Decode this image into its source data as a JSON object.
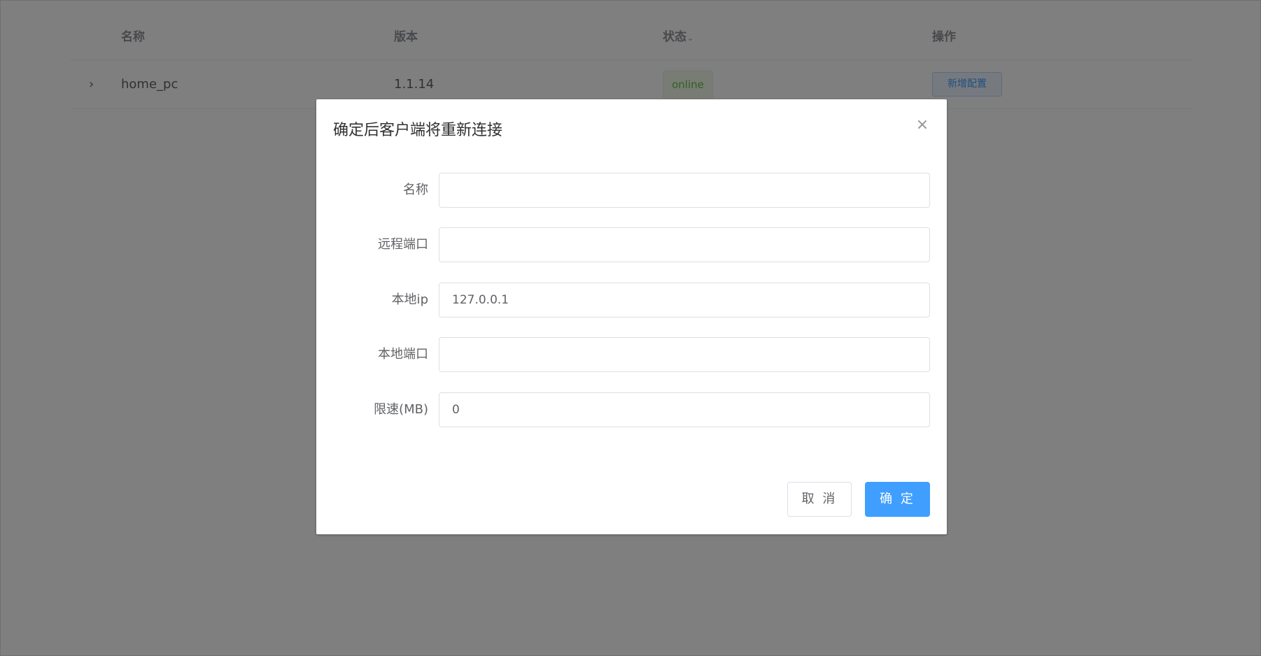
{
  "table": {
    "columns": [
      {
        "label": "名称"
      },
      {
        "label": "版本"
      },
      {
        "label": "状态",
        "sortable": true
      },
      {
        "label": "操作"
      }
    ],
    "rows": [
      {
        "name": "home_pc",
        "version": "1.1.14",
        "status": "online",
        "action": "新增配置"
      }
    ]
  },
  "icons": {
    "expand": "chevron-right-icon",
    "sort": "chevron-down-icon",
    "close": "close-icon"
  },
  "dialog": {
    "title": "确定后客户端将重新连接",
    "fields": [
      {
        "label": "名称",
        "value": ""
      },
      {
        "label": "远程端口",
        "value": ""
      },
      {
        "label": "本地ip",
        "value": "127.0.0.1"
      },
      {
        "label": "本地端口",
        "value": ""
      },
      {
        "label": "限速(MB)",
        "value": "0"
      }
    ],
    "cancel_label": "取 消",
    "ok_label": "确 定"
  },
  "colors": {
    "primary": "#409eff",
    "success": "#67c23a",
    "mask": "rgba(0,0,0,0.5)"
  }
}
